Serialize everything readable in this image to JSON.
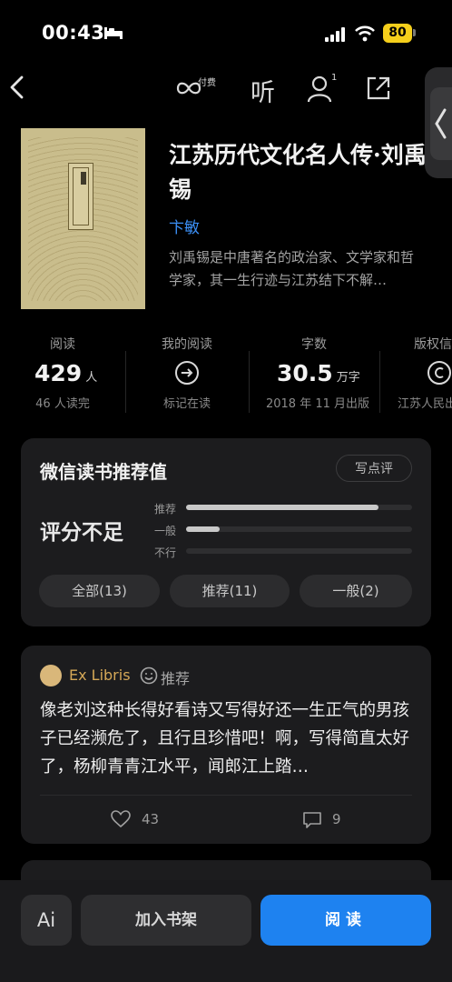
{
  "status_bar": {
    "time": "00:43",
    "battery": "80"
  },
  "nav": {
    "paid_badge": "付费",
    "listen_label": "听",
    "friends_badge": "1"
  },
  "book": {
    "title": "江苏历代文化名人传·刘禹锡",
    "author": "卞敏",
    "description": "刘禹锡是中唐著名的政治家、文学家和哲学家，其一生行迹与江苏结下不解…"
  },
  "stats": [
    {
      "label": "阅读",
      "value": "429",
      "unit": "人",
      "sub": "46 人读完"
    },
    {
      "label": "我的阅读",
      "sub": "标记在读"
    },
    {
      "label": "字数",
      "value": "30.5",
      "unit": "万字",
      "sub": "2018 年 11 月出版"
    },
    {
      "label": "版权信",
      "sub": "江苏人民出"
    }
  ],
  "rating": {
    "title": "微信读书推荐值",
    "write_btn": "写点评",
    "score_text": "评分不足",
    "bars": [
      {
        "label": "推荐",
        "fraction": 0.85
      },
      {
        "label": "一般",
        "fraction": 0.15
      },
      {
        "label": "不行",
        "fraction": 0.0
      }
    ],
    "filters": [
      "全部(13)",
      "推荐(11)",
      "一般(2)"
    ]
  },
  "review": {
    "user": "Ex Libris",
    "tag": "推荐",
    "text": "像老刘这种长得好看诗又写得好还一生正气的男孩子已经濒危了，且行且珍惜吧！啊，写得简直太好了，杨柳青青江水平，闻郎江上踏…",
    "likes": "43",
    "comments": "9"
  },
  "bottom": {
    "ai_label": "Ai",
    "shelf": "加入书架",
    "read": "阅读"
  }
}
